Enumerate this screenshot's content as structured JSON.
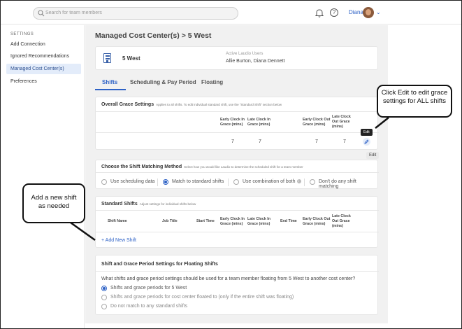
{
  "topbar": {
    "search_placeholder": "Search for team members",
    "user_name": "Diana",
    "icons": [
      "search-icon",
      "bell-icon",
      "help-icon",
      "chevron-down-icon"
    ]
  },
  "sidebar": {
    "heading": "SETTINGS",
    "items": [
      {
        "label": "Add Connection",
        "active": false
      },
      {
        "label": "Ignored Recommendations",
        "active": false
      },
      {
        "label": "Managed Cost Center(s)",
        "active": true
      },
      {
        "label": "Preferences",
        "active": false
      }
    ]
  },
  "main": {
    "breadcrumb": "Managed Cost Center(s)",
    "breadcrumb_sep": ">",
    "breadcrumb_current": "5 West",
    "cost_center": {
      "name": "5 West",
      "active_users_label": "Active Laudio Users",
      "active_users_value": "Allie Burton, Diana Dennett"
    },
    "tabs": [
      {
        "label": "Shifts",
        "active": true
      },
      {
        "label": "Scheduling & Pay Period",
        "active": false
      },
      {
        "label": "Floating",
        "active": false
      }
    ],
    "grace": {
      "title": "Overall Grace Settings",
      "subtitle": "Applies to all shifts. To edit individual standard shift, use the \"Standard Shift\" section below",
      "headers": [
        "Early Clock In Grace (mins)",
        "Late Clock In Grace (mins)",
        "Early Clock Out Grace (mins)",
        "Late Clock Out Grace (mins)"
      ],
      "values": [
        "7",
        "7",
        "7",
        "7"
      ],
      "edit_tooltip": "Edit",
      "edit_chip": "Edit"
    },
    "matching": {
      "title": "Choose the Shift Matching Method",
      "subtitle": "Select how you would like Laudio to determine the scheduled shift for a team member",
      "options": [
        {
          "label": "Use scheduling data",
          "selected": false
        },
        {
          "label": "Match to standard shifts",
          "selected": true
        },
        {
          "label": "Use combination of both",
          "selected": false
        },
        {
          "label": "Don't do any shift matching",
          "selected": false
        }
      ]
    },
    "standard": {
      "title": "Standard Shifts",
      "subtitle": "Adjust settings for individual shifts below",
      "headers": [
        "Shift Name",
        "Job Title",
        "Start Time",
        "Early Clock In Grace (mins)",
        "Late Clock In Grace (mins)",
        "End Time",
        "Early Clock Out Grace (mins)",
        "Late Clock Out Grace (mins)"
      ],
      "add_label": "+ Add New Shift"
    },
    "floating": {
      "title": "Shift and Grace Period Settings for Floating Shifts",
      "question": "What shifts and grace period settings should be used for a team member floating from 5 West to another cost center?",
      "options": [
        {
          "label": "Shifts and grace periods for 5 West",
          "selected": true
        },
        {
          "label": "Shifts and grace periods for cost center floated to (only if the entire shift was floating)",
          "selected": false
        },
        {
          "label": "Do not match to any standard shifts",
          "selected": false
        }
      ]
    }
  },
  "callouts": {
    "edit": "Click Edit to edit grace settings for ALL shifts",
    "add": "Add a new shift as needed"
  },
  "colors": {
    "accent": "#2e62c6",
    "sidebar_active": "#e3ecfa",
    "page_bg": "#f1f1f1"
  }
}
